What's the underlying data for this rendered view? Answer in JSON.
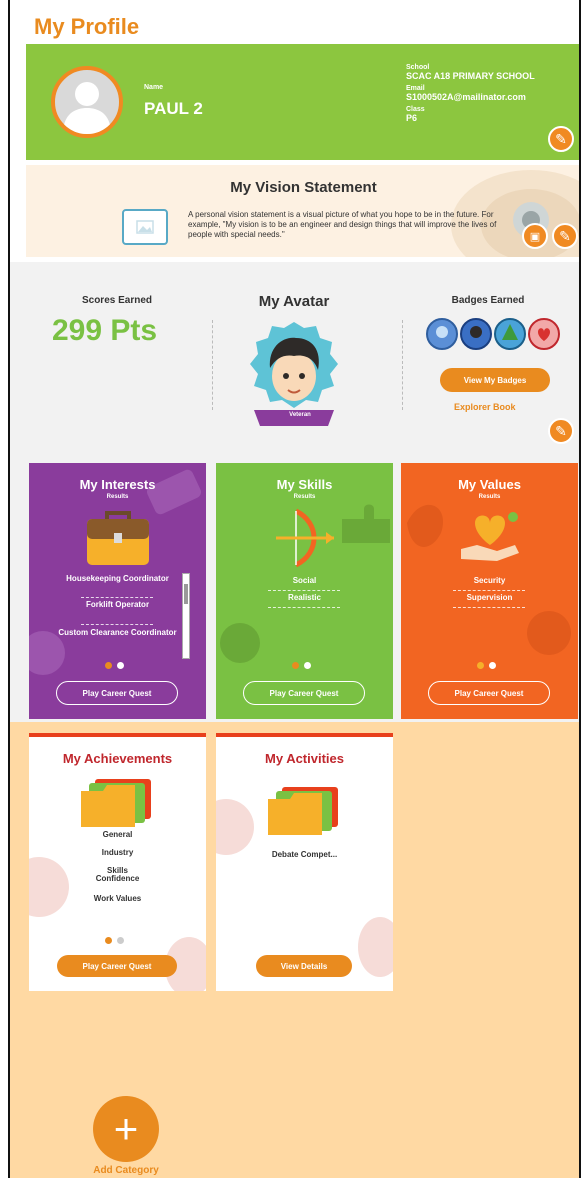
{
  "page": {
    "title": "My Profile"
  },
  "profile": {
    "name_label": "Name",
    "name": "PAUL 2",
    "school_label": "School",
    "school": "SCAC A18 PRIMARY SCHOOL",
    "email_label": "Email",
    "email": "S1000502A@mailinator.com",
    "class_label": "Class",
    "class": "P6"
  },
  "vision": {
    "title": "My Vision Statement",
    "text": "A personal vision statement is a visual picture of what you hope to be in the future. For example, \"My vision is to be an engineer and design things that will improve the lives of people with special needs.\""
  },
  "scores": {
    "label": "Scores Earned",
    "value": "299 Pts"
  },
  "avatar": {
    "title": "My Avatar",
    "rank": "Veteran"
  },
  "badges": {
    "label": "Badges Earned",
    "button": "View My Badges",
    "explorer": "Explorer Book"
  },
  "interests": {
    "title": "My Interests",
    "sub": "Results",
    "items": [
      "Housekeeping Coordinator",
      "Forklift Operator",
      "Custom Clearance Coordinator"
    ],
    "button": "Play Career Quest"
  },
  "skills": {
    "title": "My Skills",
    "sub": "Results",
    "items": [
      "Social",
      "Realistic"
    ],
    "button": "Play Career Quest"
  },
  "values": {
    "title": "My Values",
    "sub": "Results",
    "items": [
      "Security",
      "Supervision"
    ],
    "button": "Play Career Quest"
  },
  "achievements": {
    "title": "My Achievements",
    "items": [
      "General",
      "Industry",
      "Skills Confidence",
      "Work Values"
    ],
    "button": "Play Career Quest"
  },
  "activities": {
    "title": "My Activities",
    "items": [
      "Debate Compet..."
    ],
    "button": "View Details"
  },
  "add_category": {
    "label": "Add Category"
  },
  "colors": {
    "orange": "#e98b1f",
    "green": "#8cc63f",
    "purple": "#8a3c9c",
    "skills_green": "#7ac143",
    "values_orange": "#f26522",
    "peach": "#ffd9a3"
  }
}
